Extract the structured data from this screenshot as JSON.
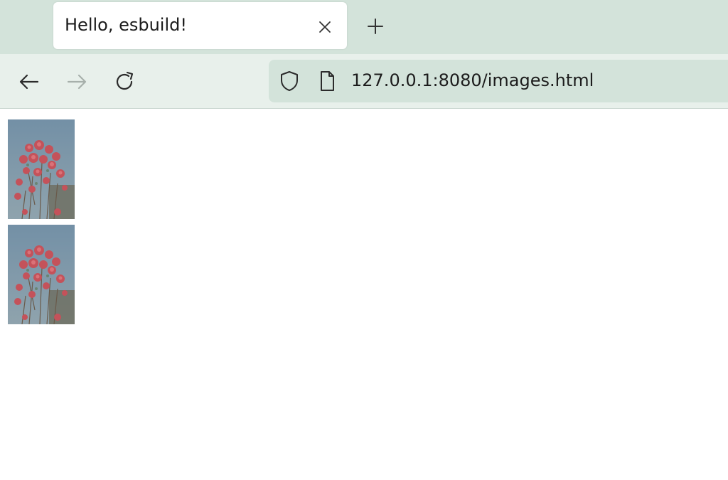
{
  "tab": {
    "title": "Hello, esbuild!",
    "close_icon": "close-icon"
  },
  "new_tab_icon": "plus-icon",
  "nav": {
    "back_icon": "arrow-left-icon",
    "forward_icon": "arrow-right-icon",
    "reload_icon": "reload-icon"
  },
  "address": {
    "url": "127.0.0.1:8080/images.html",
    "security_icon": "shield-icon",
    "page_icon": "page-icon"
  },
  "images": [
    {
      "subject": "red-flowers-photo"
    },
    {
      "subject": "red-flowers-photo"
    }
  ],
  "colors": {
    "tabbar_bg": "#d3e3da",
    "navbar_bg": "#e8f0eb",
    "sky": "#7d97a8",
    "flower": "#c4525a"
  }
}
